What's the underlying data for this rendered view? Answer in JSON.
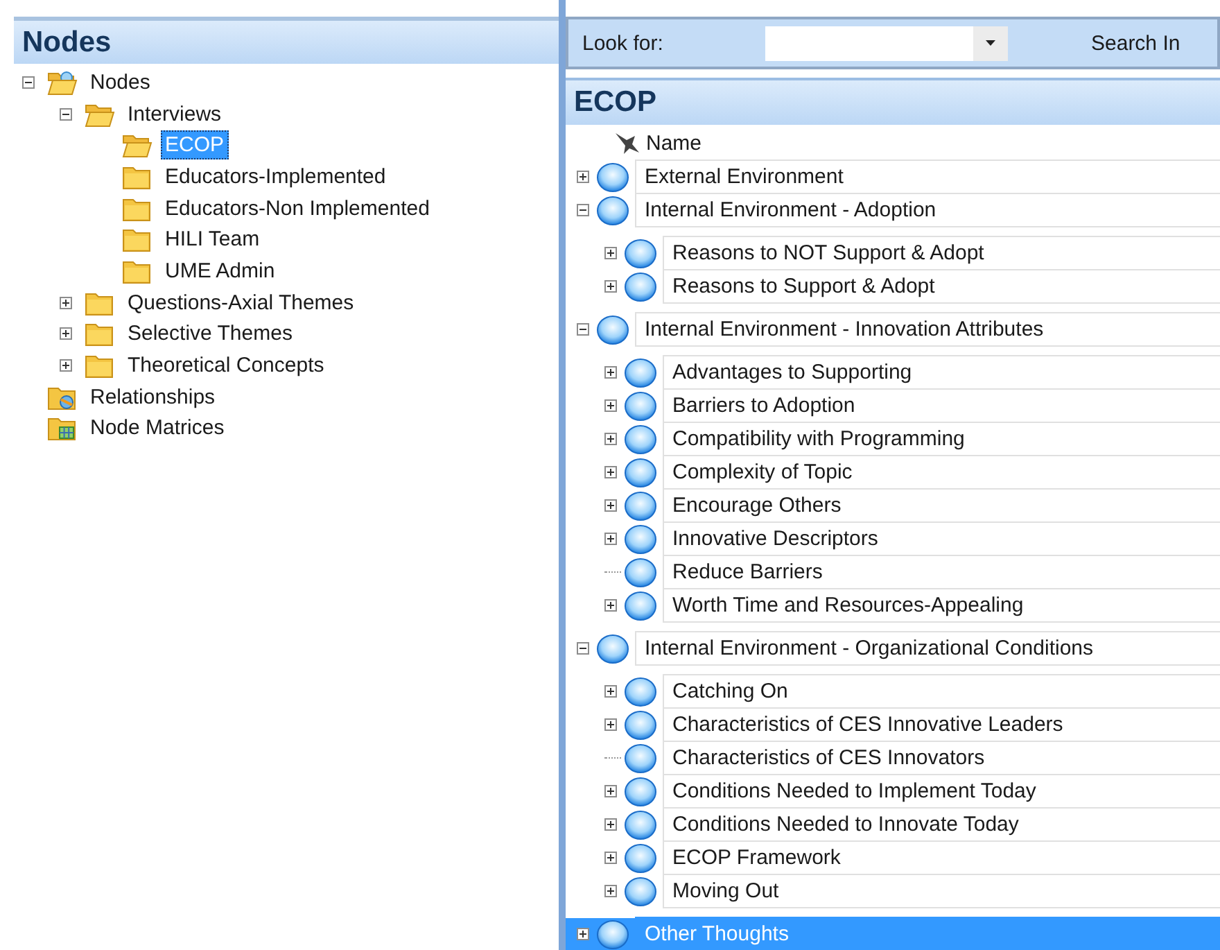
{
  "left_panel": {
    "title": "Nodes",
    "tree": [
      {
        "label": "Nodes",
        "kind": "nodes-folder",
        "expandable": true,
        "expanded": true,
        "selected": false,
        "children": [
          {
            "label": "Interviews",
            "kind": "open-folder",
            "expandable": true,
            "expanded": true,
            "selected": false,
            "children": [
              {
                "label": "ECOP",
                "kind": "open-folder",
                "expandable": false,
                "expanded": false,
                "selected": true
              },
              {
                "label": "Educators-Implemented",
                "kind": "folder",
                "expandable": false,
                "expanded": false,
                "selected": false
              },
              {
                "label": "Educators-Non Implemented",
                "kind": "folder",
                "expandable": false,
                "expanded": false,
                "selected": false
              },
              {
                "label": "HILI Team",
                "kind": "folder",
                "expandable": false,
                "expanded": false,
                "selected": false
              },
              {
                "label": "UME Admin",
                "kind": "folder",
                "expandable": false,
                "expanded": false,
                "selected": false
              }
            ]
          },
          {
            "label": "Questions-Axial Themes",
            "kind": "folder",
            "expandable": true,
            "expanded": false,
            "selected": false
          },
          {
            "label": "Selective Themes",
            "kind": "folder",
            "expandable": true,
            "expanded": false,
            "selected": false
          },
          {
            "label": "Theoretical Concepts",
            "kind": "folder",
            "expandable": true,
            "expanded": false,
            "selected": false
          }
        ]
      },
      {
        "label": "Relationships",
        "kind": "relationships-folder",
        "expandable": false,
        "expanded": false,
        "selected": false
      },
      {
        "label": "Node Matrices",
        "kind": "matrix-folder",
        "expandable": false,
        "expanded": false,
        "selected": false
      }
    ]
  },
  "find_bar": {
    "label": "Look for:",
    "search_in": "Search In"
  },
  "detail": {
    "title": "ECOP",
    "column": "Name",
    "rows": [
      {
        "name": "External Environment",
        "expandable": true,
        "expanded": false,
        "selected": false
      },
      {
        "name": "Internal Environment - Adoption",
        "expandable": true,
        "expanded": true,
        "selected": false,
        "children": [
          {
            "name": "Reasons to NOT Support & Adopt",
            "expandable": true,
            "expanded": false,
            "selected": false
          },
          {
            "name": "Reasons to Support & Adopt",
            "expandable": true,
            "expanded": false,
            "selected": false
          }
        ]
      },
      {
        "name": "Internal Environment - Innovation Attributes",
        "expandable": true,
        "expanded": true,
        "selected": false,
        "children": [
          {
            "name": "Advantages to Supporting",
            "expandable": true,
            "expanded": false,
            "selected": false
          },
          {
            "name": "Barriers to Adoption",
            "expandable": true,
            "expanded": false,
            "selected": false
          },
          {
            "name": "Compatibility with Programming",
            "expandable": true,
            "expanded": false,
            "selected": false
          },
          {
            "name": "Complexity of Topic",
            "expandable": true,
            "expanded": false,
            "selected": false
          },
          {
            "name": "Encourage Others",
            "expandable": true,
            "expanded": false,
            "selected": false
          },
          {
            "name": "Innovative Descriptors",
            "expandable": true,
            "expanded": false,
            "selected": false
          },
          {
            "name": "Reduce Barriers",
            "expandable": false,
            "expanded": false,
            "selected": false
          },
          {
            "name": "Worth Time and Resources-Appealing",
            "expandable": true,
            "expanded": false,
            "selected": false
          }
        ]
      },
      {
        "name": "Internal Environment - Organizational Conditions",
        "expandable": true,
        "expanded": true,
        "selected": false,
        "children": [
          {
            "name": "Catching On",
            "expandable": true,
            "expanded": false,
            "selected": false
          },
          {
            "name": "Characteristics of CES Innovative Leaders",
            "expandable": true,
            "expanded": false,
            "selected": false
          },
          {
            "name": "Characteristics of CES Innovators",
            "expandable": false,
            "expanded": false,
            "selected": false
          },
          {
            "name": "Conditions Needed to Implement Today",
            "expandable": true,
            "expanded": false,
            "selected": false
          },
          {
            "name": "Conditions Needed to Innovate Today",
            "expandable": true,
            "expanded": false,
            "selected": false
          },
          {
            "name": "ECOP Framework",
            "expandable": true,
            "expanded": false,
            "selected": false
          },
          {
            "name": "Moving Out",
            "expandable": true,
            "expanded": false,
            "selected": false
          }
        ]
      },
      {
        "name": "Other Thoughts",
        "expandable": true,
        "expanded": false,
        "selected": true
      }
    ]
  }
}
